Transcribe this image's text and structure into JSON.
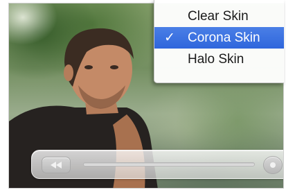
{
  "skin_menu": {
    "items": [
      {
        "label": "Clear Skin",
        "checked": false
      },
      {
        "label": "Corona Skin",
        "checked": true
      },
      {
        "label": "Halo Skin",
        "checked": false
      }
    ],
    "check_glyph": "✓",
    "selected_color": "#2f66dc"
  },
  "controller": {
    "left_button_icon": "rewind-icon",
    "right_button_icon": "volume-icon",
    "progress": 0.0
  }
}
